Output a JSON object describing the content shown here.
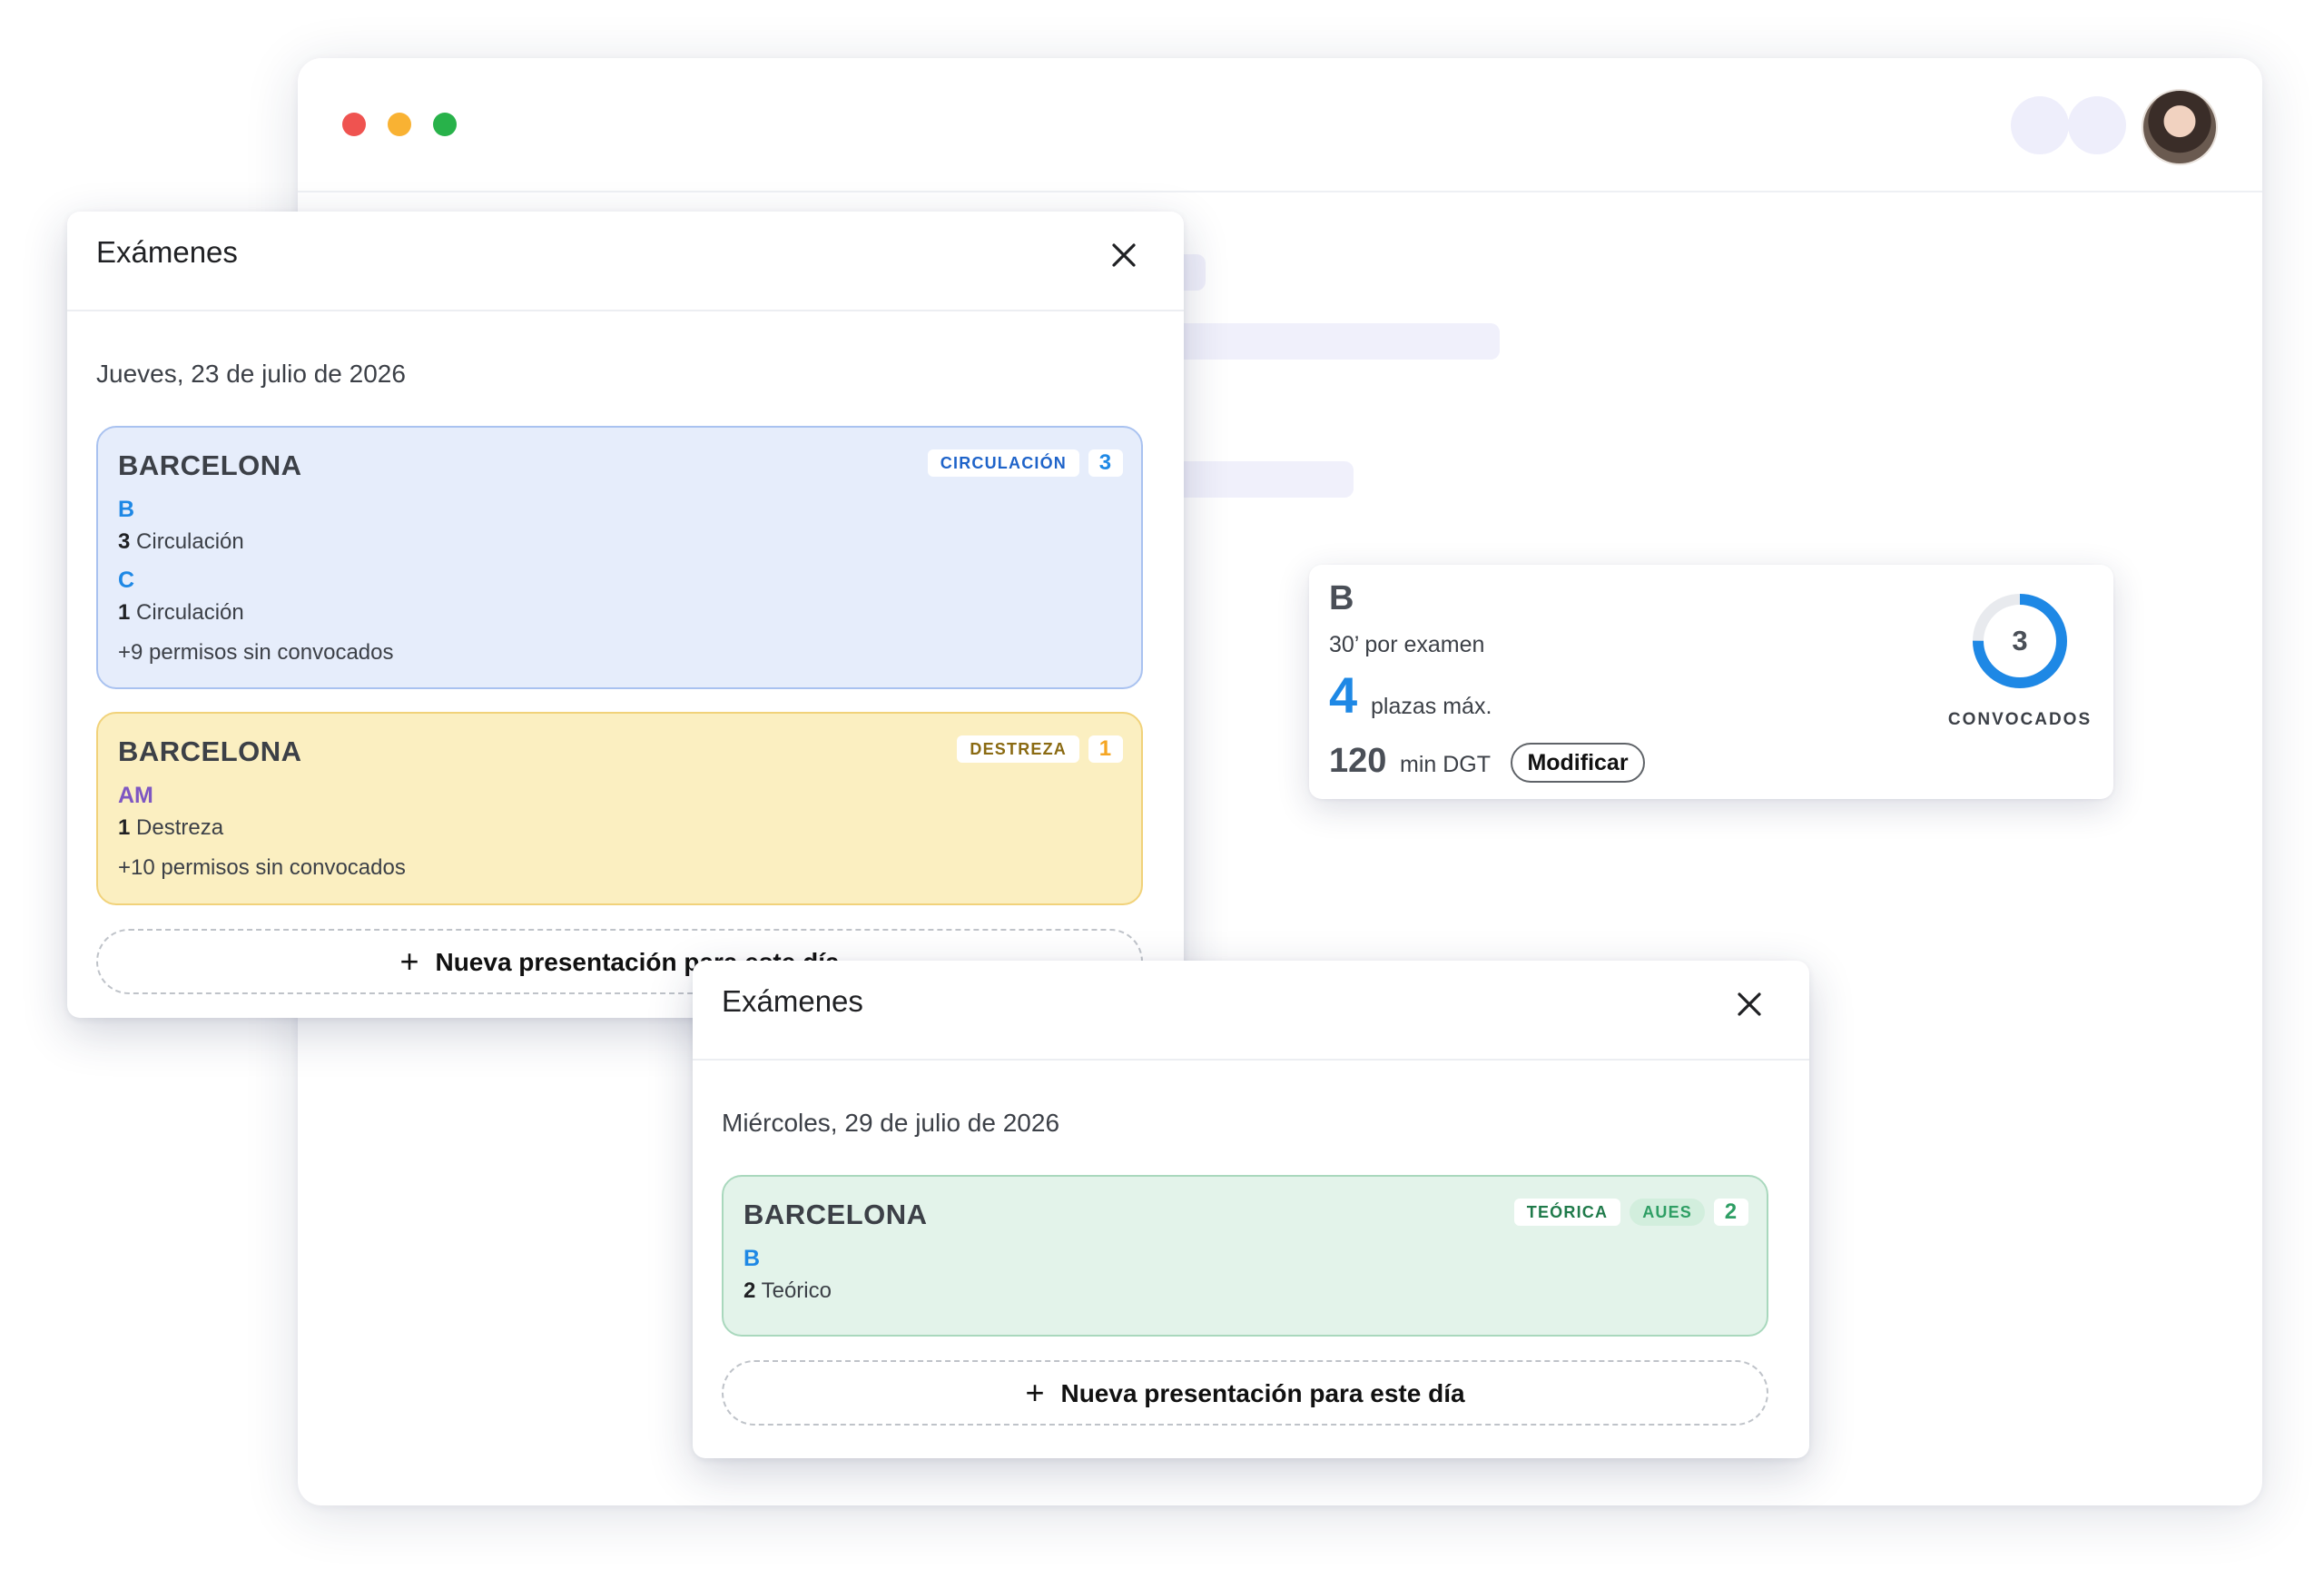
{
  "browser": {
    "controls": [
      "close",
      "minimize",
      "maximize"
    ],
    "avatar": "user-avatar"
  },
  "info_card": {
    "letter": "B",
    "per_exam": "30’ por examen",
    "plazas_value": "4",
    "plazas_label": "plazas máx.",
    "minutes_value": "120",
    "minutes_label": "min DGT",
    "modify_label": "Modificar",
    "convocados_value": "3",
    "convocados_label": "CONVOCADOS",
    "convocados_fill": 0.75,
    "accent": "#1e88e5"
  },
  "modal1": {
    "title": "Exámenes",
    "date": "Jueves, 23 de julio de 2026",
    "cards": [
      {
        "city": "BARCELONA",
        "badge": "CIRCULACIÓN",
        "count": "3",
        "lic1": "B",
        "lic1_n": "3",
        "lic1_text": "Circulación",
        "lic2": "C",
        "lic2_n": "1",
        "lic2_text": "Circulación",
        "extra": "+9 permisos sin convocados",
        "color": "#e6edfb"
      },
      {
        "city": "BARCELONA",
        "badge": "DESTREZA",
        "count": "1",
        "lic1": "AM",
        "lic1_n": "1",
        "lic1_text": "Destreza",
        "extra": "+10 permisos sin convocados",
        "color": "#fbefc1"
      }
    ],
    "new_label": "Nueva presentación para este día"
  },
  "modal2": {
    "title": "Exámenes",
    "date": "Miércoles, 29 de julio de 2026",
    "card": {
      "city": "BARCELONA",
      "badge1": "TEÓRICA",
      "badge2": "AUES",
      "count": "2",
      "lic1": "B",
      "lic1_n": "2",
      "lic1_text": "Teórico",
      "color": "#e3f3ea"
    },
    "new_label": "Nueva presentación para este día"
  }
}
